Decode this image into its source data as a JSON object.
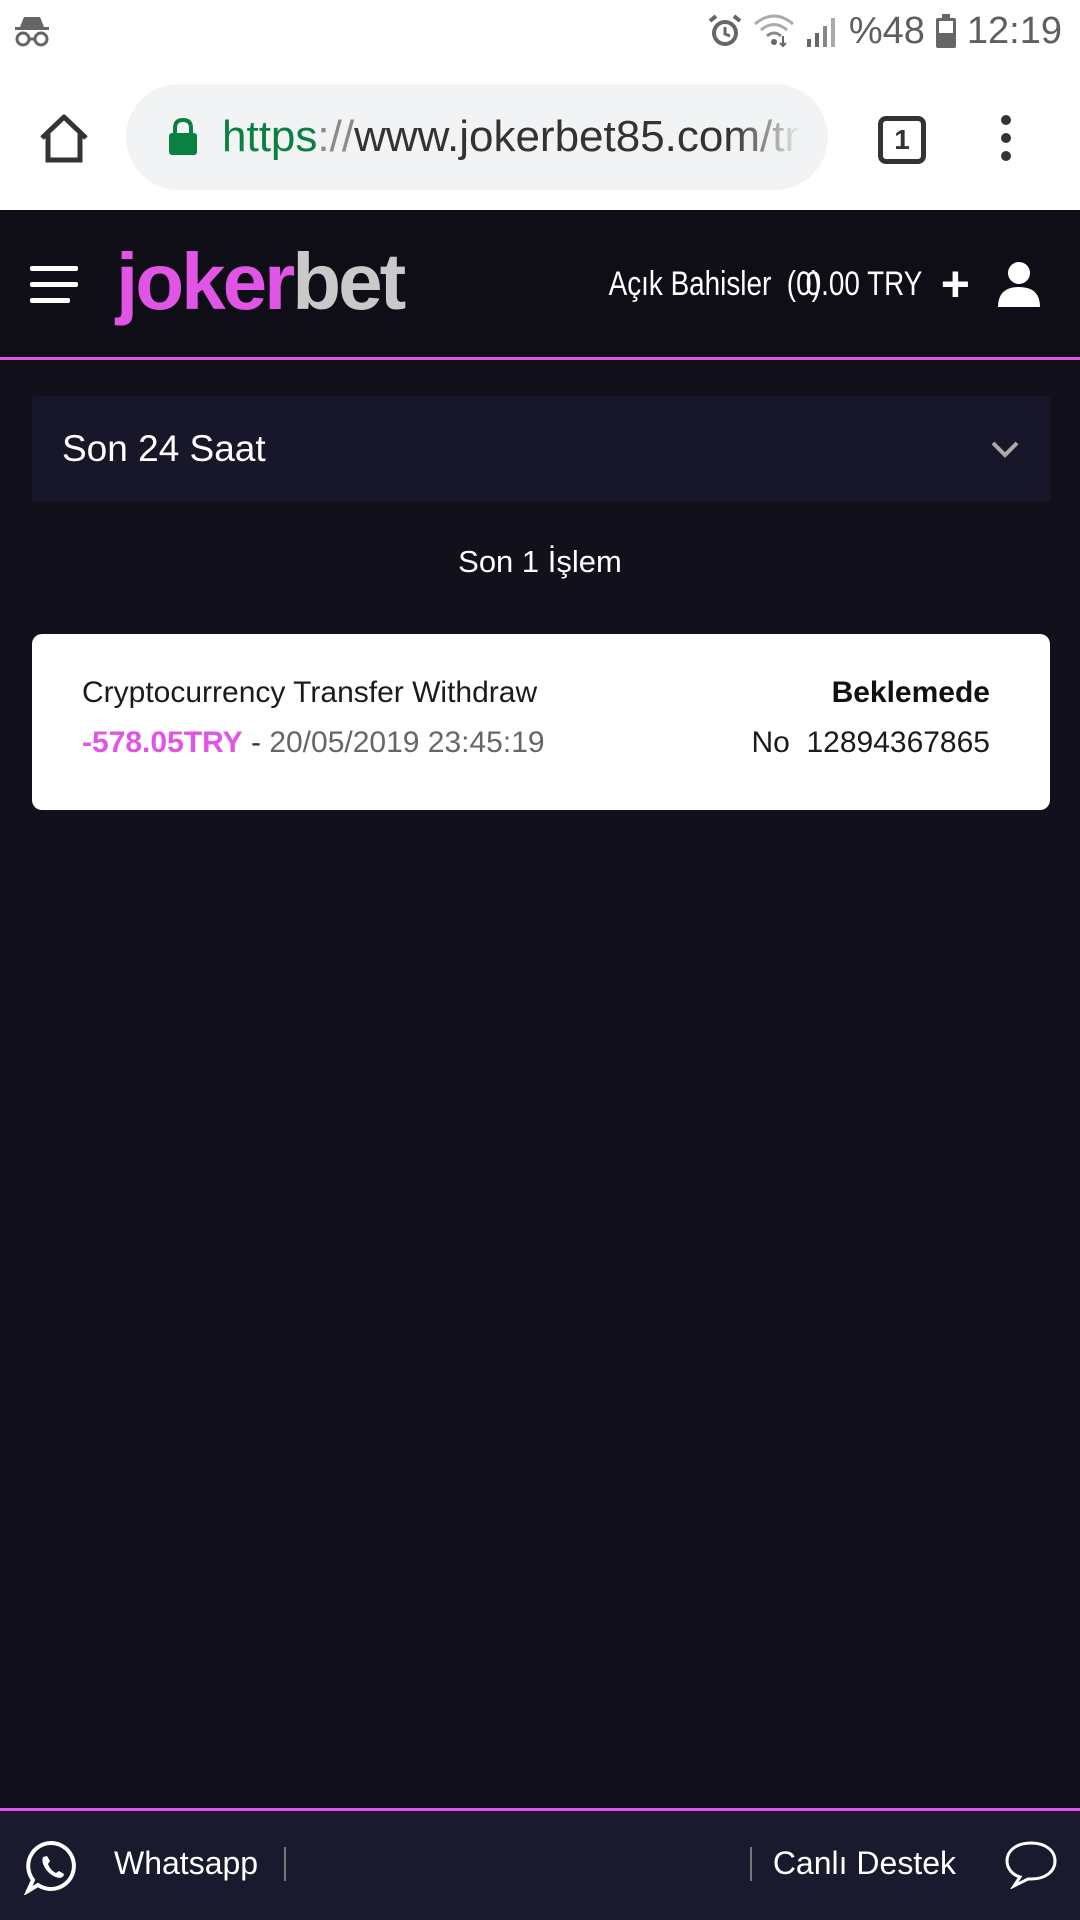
{
  "status_bar": {
    "battery_text": "%48",
    "time": "12:19"
  },
  "browser": {
    "url_scheme": "https",
    "url_separator": "://",
    "url_rest": "www.jokerbet85.com/tr",
    "tab_count": "1"
  },
  "header": {
    "logo_part1": "joker",
    "logo_part2": "bet",
    "open_bets_label": "Açık Bahisler",
    "open_bets_count": "(0)",
    "balance": "0.00 TRY",
    "plus_symbol": "+"
  },
  "filter": {
    "selected": "Son 24 Saat"
  },
  "transactions": {
    "count_label": "Son 1 İşlem",
    "items": [
      {
        "title": "Cryptocurrency Transfer Withdraw",
        "amount": "-578.05TRY",
        "separator": " - ",
        "datetime": "20/05/2019 23:45:19",
        "status": "Beklemede",
        "number": "No  12894367865"
      }
    ]
  },
  "footer": {
    "whatsapp_label": "Whatsapp",
    "live_support_label": "Canlı Destek"
  },
  "colors": {
    "accent": "#e055e6",
    "background": "#11101b",
    "header_bg": "#0f0e16",
    "filter_bg": "#171729",
    "footer_bg": "#1a1a2e",
    "url_green": "#0b8043"
  },
  "icons": [
    "incognito-icon",
    "alarm-icon",
    "wifi-icon",
    "signal-icon",
    "battery-icon",
    "home-icon",
    "lock-icon",
    "tabs-icon",
    "overflow-menu-icon",
    "hamburger-icon",
    "user-icon",
    "chevron-down-icon",
    "whatsapp-icon",
    "chat-bubble-icon"
  ]
}
